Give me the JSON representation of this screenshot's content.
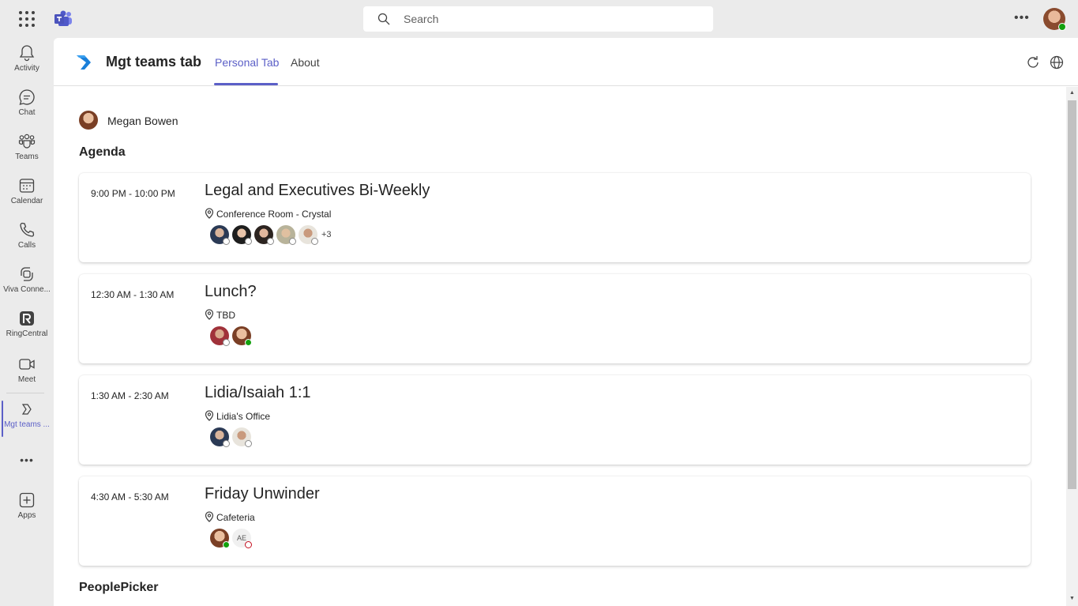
{
  "search": {
    "placeholder": "Search"
  },
  "rail": {
    "items": [
      {
        "label": "Activity",
        "icon": "bell-icon"
      },
      {
        "label": "Chat",
        "icon": "chat-icon"
      },
      {
        "label": "Teams",
        "icon": "teams-icon"
      },
      {
        "label": "Calendar",
        "icon": "calendar-icon"
      },
      {
        "label": "Calls",
        "icon": "phone-icon"
      },
      {
        "label": "Viva Conne...",
        "icon": "viva-connections-icon"
      },
      {
        "label": "RingCentral",
        "icon": "ringcentral-icon"
      },
      {
        "label": "Meet",
        "icon": "video-icon"
      },
      {
        "label": "Mgt teams ...",
        "icon": "mgt-app-icon"
      },
      {
        "label": "Apps",
        "icon": "add-apps-icon"
      }
    ]
  },
  "app": {
    "title": "Mgt teams tab",
    "tabs": [
      {
        "label": "Personal Tab"
      },
      {
        "label": "About"
      }
    ]
  },
  "person": {
    "name": "Megan Bowen"
  },
  "agenda": {
    "title": "Agenda",
    "events": [
      {
        "time": "9:00 PM - 10:00 PM",
        "subject": "Legal and Executives Bi-Weekly",
        "location": "Conference Room - Crystal",
        "more": "+3"
      },
      {
        "time": "12:30 AM - 1:30 AM",
        "subject": "Lunch?",
        "location": "TBD"
      },
      {
        "time": "1:30 AM - 2:30 AM",
        "subject": "Lidia/Isaiah 1:1",
        "location": "Lidia's Office"
      },
      {
        "time": "4:30 AM - 5:30 AM",
        "subject": "Friday Unwinder",
        "location": "Cafeteria",
        "initials": "AE"
      }
    ]
  },
  "peoplepicker": {
    "title": "PeoplePicker"
  },
  "colors": {
    "accent": "#5b5fc7",
    "available": "#13a10e",
    "offline": "#c50f1f"
  }
}
